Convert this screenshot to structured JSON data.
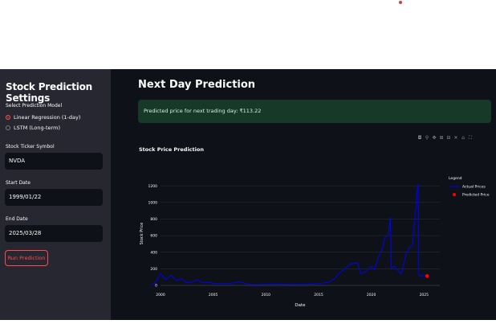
{
  "sidebar": {
    "title": "Stock Prediction Settings",
    "model_label": "Select Prediction Model",
    "model_options": [
      "Linear Regression (1-day)",
      "LSTM (Long-term)"
    ],
    "model_selected": "Linear Regression (1-day)",
    "ticker_label": "Stock Ticker Symbol",
    "ticker_value": "NVDA",
    "start_label": "Start Date",
    "start_value": "1999/01/22",
    "end_label": "End Date",
    "end_value": "2025/03/28",
    "run_button": "Run Prediction"
  },
  "main": {
    "title": "Next Day Prediction",
    "prediction_message": "Predicted price for next trading day: ₹113.22",
    "toolbar_icons": [
      "camera-icon",
      "zoom-icon",
      "pan-icon",
      "zoom-in-icon",
      "zoom-out-icon",
      "autoscale-icon",
      "reset-axes-icon",
      "fullscreen-icon"
    ]
  },
  "colors": {
    "accent": "#ff4b4b",
    "actual_line": "#0000ff",
    "predicted_marker": "#ff0000",
    "success_bg": "#173928"
  },
  "chart_data": {
    "type": "line",
    "title": "Stock Price Prediction",
    "xlabel": "Date",
    "ylabel": "Stock Price",
    "x_ticks": [
      "2000",
      "2005",
      "2010",
      "2015",
      "2020",
      "2025"
    ],
    "y_ticks": [
      0,
      200,
      400,
      600,
      800,
      1000,
      1200
    ],
    "xlim": [
      2000,
      2026.5
    ],
    "ylim": [
      0,
      1250
    ],
    "legend_title": "Legend",
    "legend_position": "top-right",
    "series": [
      {
        "name": "Actual Prices",
        "x": [
          1999.1,
          1999.5,
          2000.0,
          2000.5,
          2001.0,
          2001.5,
          2002.0,
          2002.5,
          2003.0,
          2003.5,
          2004.0,
          2004.5,
          2005.0,
          2006.0,
          2007.0,
          2007.5,
          2008.0,
          2008.5,
          2009.0,
          2010.0,
          2011.0,
          2012.0,
          2013.0,
          2014.0,
          2015.0,
          2016.0,
          2016.5,
          2017.0,
          2017.5,
          2018.0,
          2018.7,
          2019.0,
          2019.5,
          2020.0,
          2020.3,
          2020.7,
          2021.0,
          2021.3,
          2021.6,
          2021.8,
          2021.9,
          2022.2,
          2022.5,
          2022.8,
          2023.0,
          2023.3,
          2023.6,
          2023.9,
          2024.0,
          2024.2,
          2024.4,
          2024.45,
          2024.5,
          2024.7,
          2024.9,
          2025.2
        ],
        "y": [
          5,
          30,
          140,
          70,
          120,
          60,
          80,
          30,
          40,
          70,
          30,
          40,
          25,
          20,
          30,
          45,
          25,
          10,
          8,
          12,
          15,
          10,
          12,
          15,
          20,
          40,
          80,
          150,
          200,
          260,
          270,
          140,
          170,
          230,
          190,
          350,
          420,
          580,
          600,
          820,
          210,
          230,
          180,
          140,
          210,
          380,
          450,
          480,
          650,
          900,
          1200,
          1220,
          130,
          110,
          120,
          110
        ]
      },
      {
        "name": "Predicted Price",
        "x": [
          2025.3
        ],
        "y": [
          113.22
        ]
      }
    ]
  }
}
